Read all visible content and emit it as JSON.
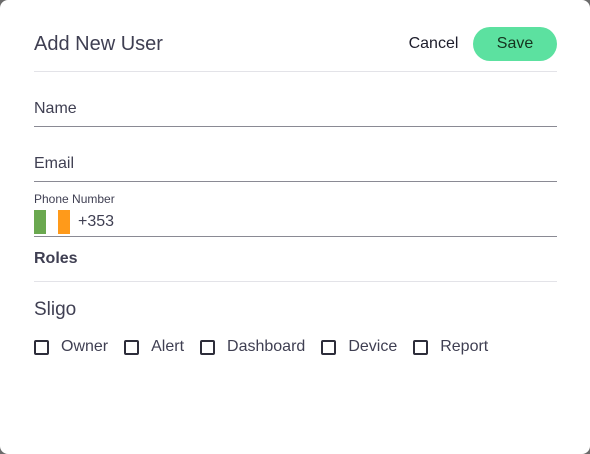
{
  "dialog": {
    "title": "Add New User",
    "cancel_label": "Cancel",
    "save_label": "Save"
  },
  "form": {
    "name_placeholder": "Name",
    "email_placeholder": "Email",
    "phone": {
      "label": "Phone Number",
      "dial_code": "+353",
      "flag_colors": [
        "#6aa84f",
        "#ffffff",
        "#ff9a1a"
      ]
    },
    "roles_label": "Roles",
    "organization": "Sligo",
    "roles": [
      {
        "label": "Owner",
        "checked": false
      },
      {
        "label": "Alert",
        "checked": false
      },
      {
        "label": "Dashboard",
        "checked": false
      },
      {
        "label": "Device",
        "checked": false
      },
      {
        "label": "Report",
        "checked": false
      }
    ]
  },
  "colors": {
    "accent": "#5ce1a0",
    "text": "#3f3f52"
  }
}
